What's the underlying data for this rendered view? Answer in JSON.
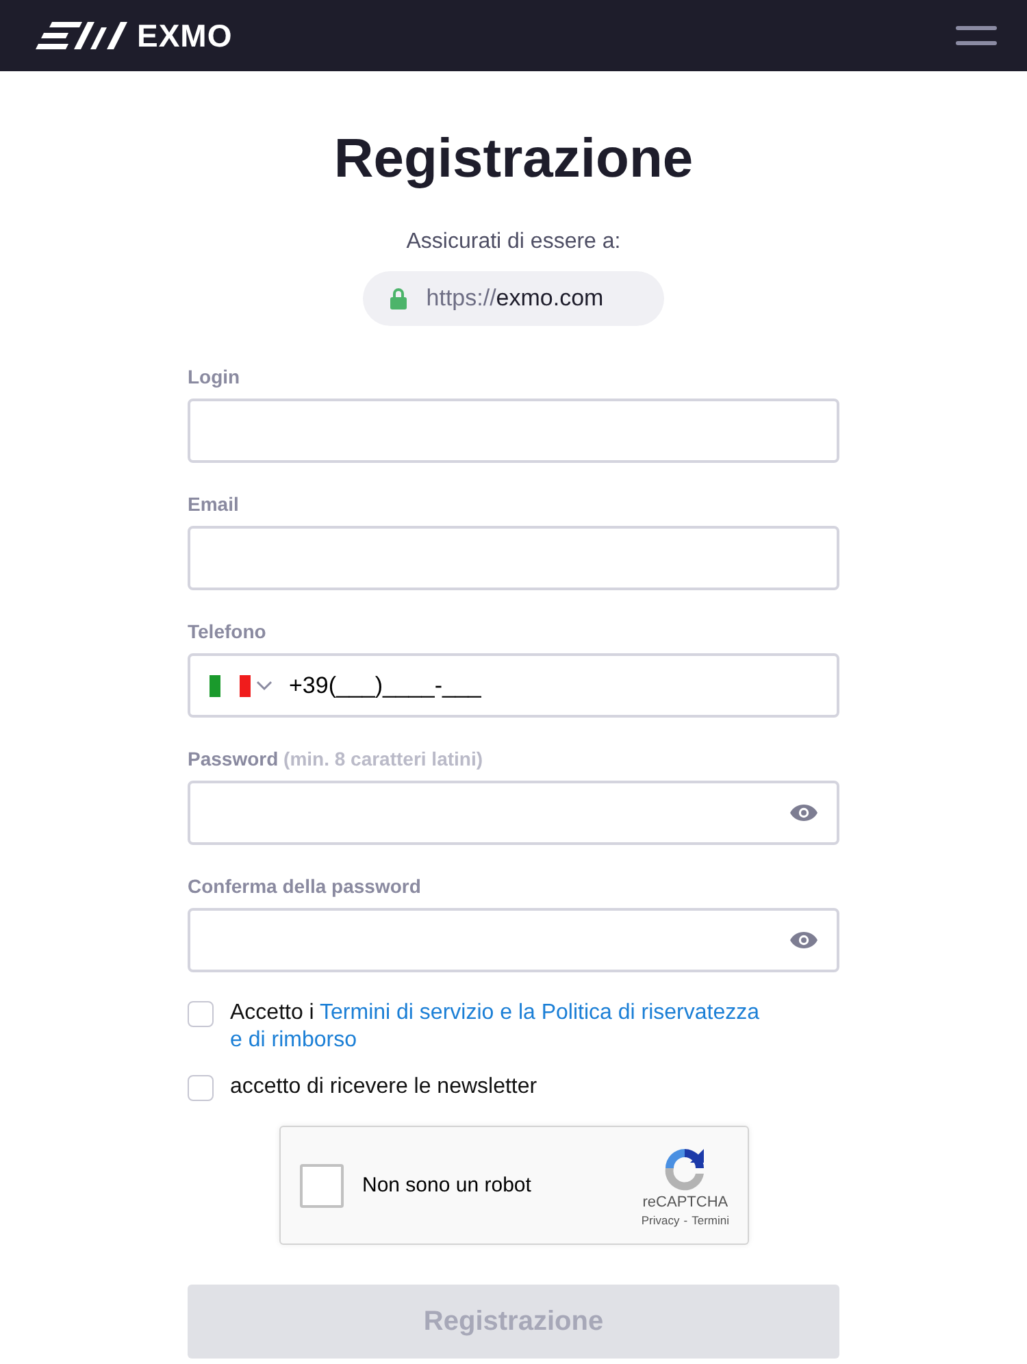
{
  "header": {
    "logo": "EXMO"
  },
  "title": "Registrazione",
  "notice": "Assicurati di essere a:",
  "url": {
    "scheme": "https://",
    "host": "exmo.com"
  },
  "fields": [
    {
      "kind": "text",
      "label": "Login"
    },
    {
      "kind": "text",
      "label": "Email"
    },
    {
      "kind": "phone",
      "label": "Telefono",
      "value": "+39(___)____-___"
    },
    {
      "kind": "password",
      "label": "Password",
      "hint": "(min. 8 caratteri latini)"
    },
    {
      "kind": "password",
      "label": "Conferma della password"
    }
  ],
  "agreements": [
    {
      "text": "Accetto i ",
      "link_lines": [
        "Termini di servizio e la Politica di riservatezza",
        "e di rimborso"
      ],
      "checked": false
    },
    {
      "text": "accetto di ricevere le newsletter",
      "checked": false
    }
  ],
  "captcha": {
    "label": "Non sono un robot",
    "checked": false,
    "brand": "reCAPTCHA",
    "privacy": "Privacy",
    "separator": "-",
    "terms": "Termini"
  },
  "submit": {
    "label": "Registrazione",
    "disabled": true
  }
}
